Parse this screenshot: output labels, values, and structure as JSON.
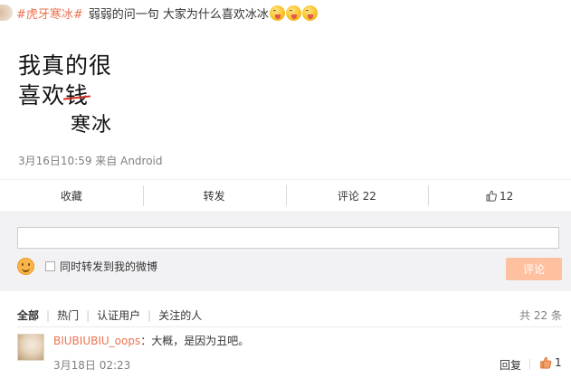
{
  "post": {
    "topic": "#虎牙寒冰#",
    "text": "弱弱的问一句 大家为什么喜欢冰冰",
    "emoji_names": [
      "yum-face-icon",
      "yum-face-icon",
      "yum-face-icon"
    ],
    "image_text": {
      "line1": "我真的很",
      "line2_prefix": "喜欢",
      "struck": "钱",
      "replacement": "寒冰"
    },
    "meta": "3月16日10:59 来自 Android"
  },
  "actions": {
    "favorite": "收藏",
    "repost": "转发",
    "comment": "评论 22",
    "like_count": "12"
  },
  "compose": {
    "placeholder": "",
    "repost_checkbox_label": "同时转发到我的微博",
    "submit_label": "评论"
  },
  "comments": {
    "filters": [
      "全部",
      "热门",
      "认证用户",
      "关注的人"
    ],
    "total": "共 22 条",
    "items": [
      {
        "user": "BIUBIUBIU_oops",
        "text": "：大概，是因为丑吧。",
        "time": "3月18日 02:23",
        "reply_label": "回复",
        "likes": "1"
      }
    ]
  },
  "colors": {
    "accent": "#eb7350",
    "submit_disabled": "#ffc09f",
    "compose_bg": "#f2f2f5",
    "strike": "#d52b1e"
  }
}
